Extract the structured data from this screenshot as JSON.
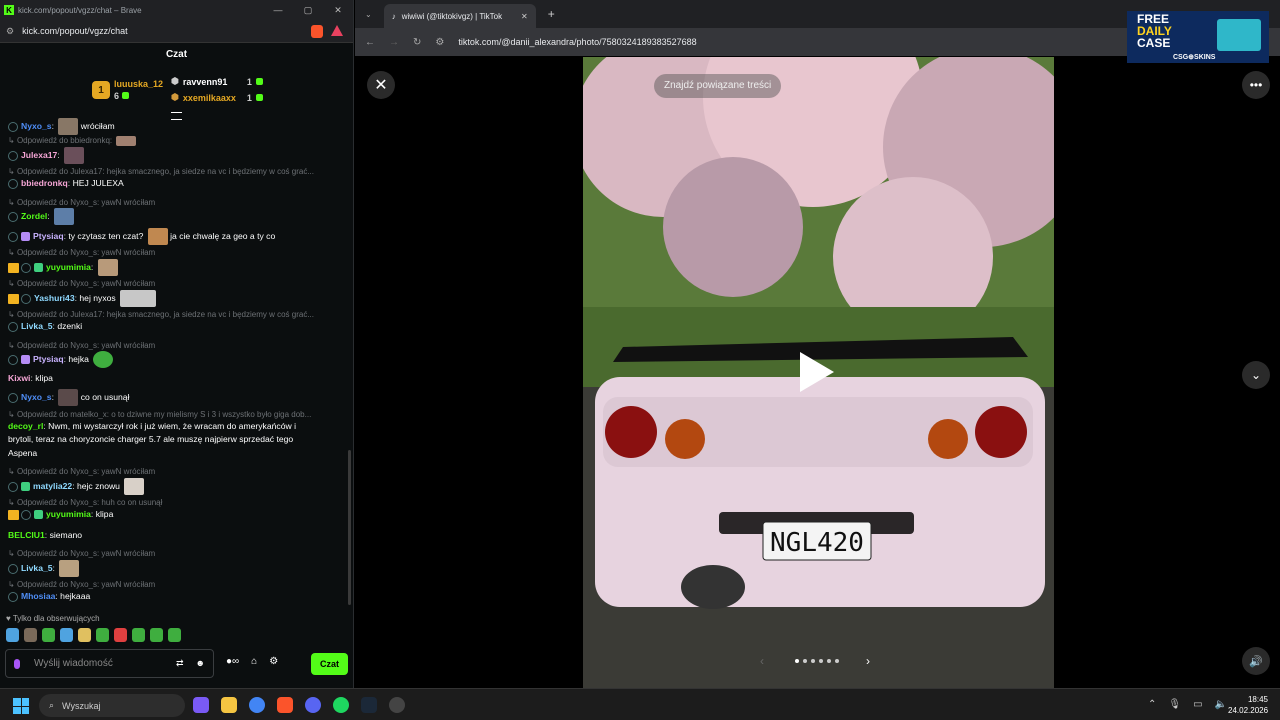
{
  "kick_window": {
    "tab_title": "kick.com/popout/vgzz/chat – Brave",
    "url": "kick.com/popout/vgzz/chat",
    "header": "Czat"
  },
  "top_gifters": [
    {
      "name": "luuuska_12",
      "count": "6"
    },
    {
      "name": "ravvenn91",
      "count": "1"
    },
    {
      "name": "xxemilkaaxx",
      "count": "1"
    }
  ],
  "chat": [
    {
      "user": "Nyxo_s",
      "text": "wróciłam",
      "reply": ""
    },
    {
      "reply": "Odpowiedź do bbiedronkq:"
    },
    {
      "user": "Julexa17",
      "text": "",
      "reply": ""
    },
    {
      "reply": "Odpowiedź do Julexa17: hejka smacznego, ja siedze na vc i będziemy w coś grać..."
    },
    {
      "user": "bbiedronkq",
      "text": "HEJ JULEXA"
    },
    {
      "reply": "Odpowiedź do Nyxo_s: yawN wróciłam"
    },
    {
      "user": "Zordel",
      "text": ""
    },
    {
      "user": "Ptysiaq",
      "text": "ty czytasz ten czat?",
      "text2": "ja cie chwalę za geo a ty co"
    },
    {
      "reply": "Odpowiedź do Nyxo_s: yawN wróciłam"
    },
    {
      "user": "yuyumimia",
      "text": ""
    },
    {
      "reply": "Odpowiedź do Nyxo_s: yawN wróciłam"
    },
    {
      "user": "Yashuri43",
      "text": "hej nyxos"
    },
    {
      "reply": "Odpowiedź do Julexa17: hejka smacznego, ja siedze na vc i będziemy w coś grać..."
    },
    {
      "user": "Livka_5",
      "text": "dzenki"
    },
    {
      "reply": "Odpowiedź do Nyxo_s: yawN wróciłam"
    },
    {
      "user": "Ptysiaq",
      "text": "hejka"
    },
    {
      "user": "Kixwi",
      "text": "klipa"
    },
    {
      "user": "Nyxo_s",
      "text": "co on usunął"
    },
    {
      "reply": "Odpowiedź do matelko_x: o to dziwne my mielismy S i 3 i wszystko było giga dob..."
    },
    {
      "user": "decoy_rl",
      "text": "Nwm, mi wystarczył rok i już wiem, że wracam do amerykańców i",
      "text2": "brytoli, teraz na choryzoncie charger 5.7 ale muszę najpierw sprzedać tego",
      "text3": "Aspena"
    },
    {
      "reply": "Odpowiedź do Nyxo_s: yawN wróciłam"
    },
    {
      "user": "matylia22",
      "text": "hejc znowu"
    },
    {
      "reply": "Odpowiedź do Nyxo_s: huh co on usunął"
    },
    {
      "user": "yuyumimia",
      "text": "klipa"
    },
    {
      "user": "BELCIU1",
      "text": "siemano"
    },
    {
      "reply": "Odpowiedź do Nyxo_s: yawN wróciłam"
    },
    {
      "user": "Livka_5",
      "text": ""
    },
    {
      "reply": "Odpowiedź do Nyxo_s: yawN wróciłam"
    },
    {
      "user": "Mhosiaa",
      "text": "hejkaaa"
    }
  ],
  "chat_footer": {
    "followers_only": "Tylko dla obserwujących",
    "placeholder": "Wyślij wiadomość",
    "send": "Czat"
  },
  "tiktok": {
    "tab_title": "wiwiwi (@tiktokivgz) | TikTok",
    "url": "tiktok.com/@danii_alexandra/photo/7580324189383527688",
    "search_pill": "Znajdź powiązane treści",
    "plate": "NGL420"
  },
  "ad": {
    "line1": "FREE",
    "line2": "DAILY",
    "line3": "CASE",
    "brand": "CSG⊕SKINS"
  },
  "taskbar": {
    "search": "Wyszukaj",
    "time": "18:45",
    "date": "24.02.2026"
  },
  "colors": {
    "green": "#53fc18",
    "kick_bg": "#0b0e0f"
  }
}
